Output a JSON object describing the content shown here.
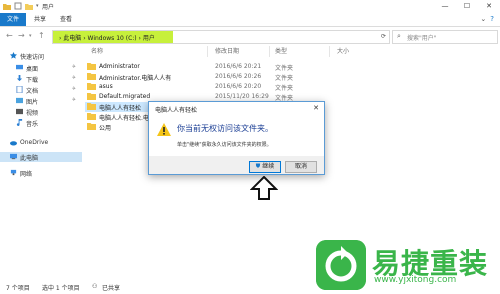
{
  "window": {
    "title": "用户",
    "minimize": "—",
    "maximize": "☐",
    "close": "✕"
  },
  "ribbon": {
    "tabs": [
      "文件",
      "共享",
      "查看"
    ]
  },
  "address": {
    "crumbs": "›  此电脑  ›  Windows 10 (C:)  ›  用户",
    "search_placeholder": "搜索\"用户\""
  },
  "nav": {
    "items": [
      {
        "label": "快速访问"
      },
      {
        "label": "桌面"
      },
      {
        "label": "下载"
      },
      {
        "label": "文档"
      },
      {
        "label": "图片"
      },
      {
        "label": "视频"
      },
      {
        "label": "音乐"
      },
      {
        "label": "OneDrive"
      },
      {
        "label": "此电脑"
      },
      {
        "label": "网络"
      }
    ]
  },
  "list": {
    "headers": [
      "名称",
      "修改日期",
      "类型",
      "大小"
    ],
    "rows": [
      {
        "name": "Administrator",
        "date": "2016/6/6 20:21",
        "type": "文件夹"
      },
      {
        "name": "Administrator.电脑人人有",
        "date": "2016/6/6 20:26",
        "type": "文件夹"
      },
      {
        "name": "asus",
        "date": "2016/6/6 20:20",
        "type": "文件夹"
      },
      {
        "name": "Default.migrated",
        "date": "2015/11/20 16:29",
        "type": "文件夹"
      },
      {
        "name": "电脑人人有轻松",
        "date": "",
        "type": ""
      },
      {
        "name": "电脑人人有轻松.电脑...",
        "date": "",
        "type": ""
      },
      {
        "name": "公用",
        "date": "",
        "type": ""
      }
    ]
  },
  "status": {
    "count": "7 个项目",
    "selected": "选中 1 个项目",
    "shared": "已共享"
  },
  "dialog": {
    "title": "电脑人人有轻松",
    "message": "你当前无权访问该文件夹。",
    "sub": "单击\"继续\"获取永久访问该文件夹的权限。",
    "continue_label": "继续",
    "cancel_label": "取消"
  },
  "watermark": {
    "text": "易捷重装",
    "url": "www.yjxitong.com"
  }
}
